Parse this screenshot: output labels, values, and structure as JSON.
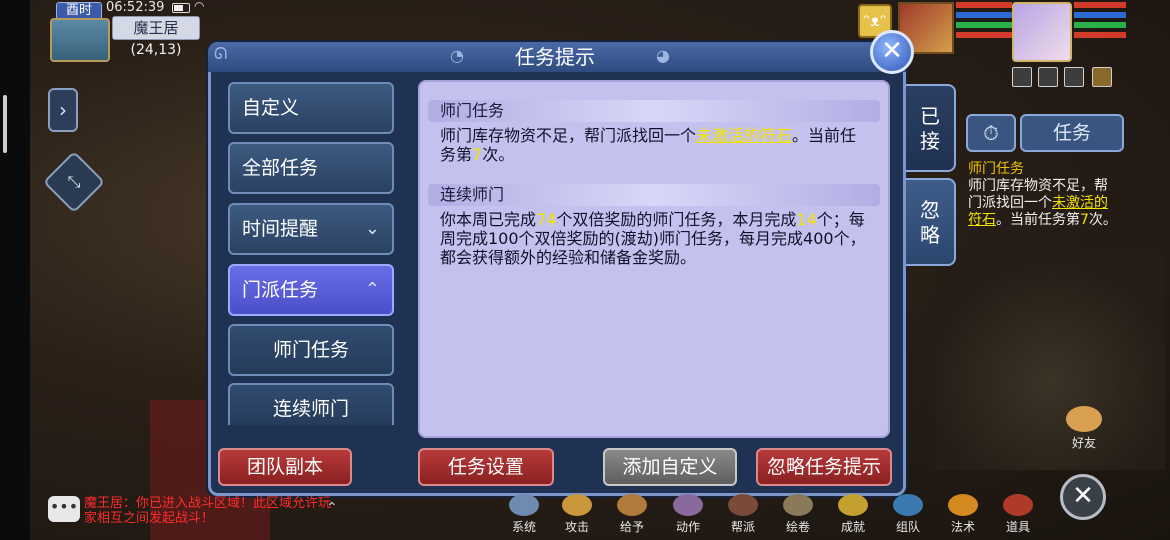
{
  "status": {
    "time_badge": "酉时",
    "clock": "06:52:39",
    "location_name": "魔王居",
    "coordinates": "(24,13)"
  },
  "dialog": {
    "title": "任务提示",
    "close_label": "✕"
  },
  "nav": {
    "items": [
      {
        "label": "自定义",
        "caret": ""
      },
      {
        "label": "全部任务",
        "caret": ""
      },
      {
        "label": "时间提醒",
        "caret": "⌄"
      },
      {
        "label": "门派任务",
        "caret": "⌃"
      },
      {
        "label": "师门任务",
        "caret": ""
      },
      {
        "label": "连续师门",
        "caret": ""
      }
    ]
  },
  "content": {
    "section1": {
      "heading": "师门任务",
      "text_a": "师门库存物资不足，帮门派找回一个",
      "link": "未激活的符石",
      "text_b": "。当前任务第",
      "count": "7",
      "text_c": "次。"
    },
    "section2": {
      "heading": "连续师门",
      "text_a": "你本周已完成",
      "week_count": "74",
      "text_b": "个双倍奖励的师门任务，本月完成",
      "month_count": "14",
      "text_c": "个；每周完成100个双倍奖励的(渡劫)师门任务，每月完成400个，都会获得额外的经验和储备金奖励。"
    }
  },
  "side_tabs": [
    {
      "label": "已接"
    },
    {
      "label": "忽略"
    }
  ],
  "buttons": {
    "team_dungeon": "团队副本",
    "task_settings": "任务设置",
    "add_custom": "添加自定义",
    "ignore_prompt": "忽略任务提示"
  },
  "tracker": {
    "timer_icon": "timer-icon",
    "task_label": "任务",
    "title": "师门任务",
    "text_a": "师门库存物资不足，帮门派找回一个",
    "link": "未激活的符石",
    "text_b": "。当前任务第",
    "count": "7",
    "text_c": "次。"
  },
  "hud": {
    "chat_icon": "chat-icon",
    "system_message": "魔王居：你已进入战斗区域！此区域允许玩家相互之间发起战斗！",
    "menu": [
      {
        "label": "系统",
        "color": "#6f8bb0"
      },
      {
        "label": "攻击",
        "color": "#c9983a"
      },
      {
        "label": "给予",
        "color": "#b07a3a"
      },
      {
        "label": "动作",
        "color": "#8a6a9e"
      },
      {
        "label": "帮派",
        "color": "#7a4a3a"
      },
      {
        "label": "绘卷",
        "color": "#8a7a5a"
      },
      {
        "label": "成就",
        "color": "#c4a030"
      },
      {
        "label": "组队",
        "color": "#3a7ab0"
      },
      {
        "label": "法术",
        "color": "#d48a20"
      },
      {
        "label": "道具",
        "color": "#b03a2a"
      }
    ],
    "friends_label": "好友",
    "close_label": "✕"
  },
  "colors": {
    "dialog_bg": "#1f3253",
    "content_bg": "#c4c1ee",
    "active_tab": "#4a4fc8",
    "highlight": "#f2e400",
    "danger_button": "#b83a3a"
  }
}
